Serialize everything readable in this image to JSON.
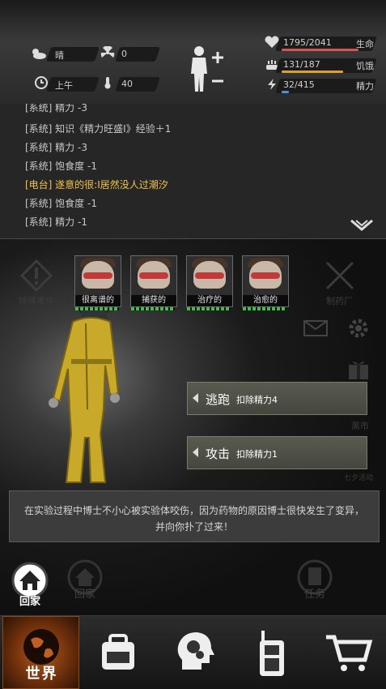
{
  "status": {
    "weather": "晴",
    "radiation": "0",
    "time": "上午",
    "temperature": "40",
    "life": {
      "value": "1795/2041",
      "label": "生命",
      "fraction": 0.88
    },
    "hunger": {
      "value": "131/187",
      "label": "饥饿",
      "fraction": 0.7
    },
    "energy": {
      "value": "32/415",
      "label": "精力",
      "fraction": 0.08
    }
  },
  "log": [
    {
      "text": "[系统] 精力 -3",
      "type": "system"
    },
    {
      "text": "[系统] 知识《精力旺盛Ⅰ》经验＋1",
      "type": "system"
    },
    {
      "text": "[系统] 精力 -3",
      "type": "system"
    },
    {
      "text": "[系统] 饱食度 -1",
      "type": "system"
    },
    {
      "text": "[电台] 遂意的很:I居然没人过潮汐",
      "type": "radio"
    },
    {
      "text": "[系统] 饱食度 -1",
      "type": "system"
    },
    {
      "text": "[系统] 精力 -1",
      "type": "system"
    }
  ],
  "enemies": [
    {
      "name": "很离谱的"
    },
    {
      "name": "捕获的"
    },
    {
      "name": "治疗的"
    },
    {
      "name": "治愈的"
    }
  ],
  "enemy_hp_fraction": [
    1,
    1,
    1,
    1
  ],
  "actions": [
    {
      "label": "逃跑",
      "cost": "扣除精力4"
    },
    {
      "label": "攻击",
      "cost": "扣除精力1"
    }
  ],
  "side_labels": {
    "special_event": "特殊事件",
    "pharmacy": "制药厂",
    "black_market": "黑市",
    "seven_day": "七夕活动"
  },
  "story": "在实验过程中博士不小心被实验体咬伤，因为药物的原因博士很快发生了变异，并向你扑了过来！",
  "home": {
    "active_label": "回家",
    "faded_label": "回家",
    "task_label": "任务"
  },
  "nav": {
    "world": "世界"
  },
  "colors": {
    "life": "#d9534f",
    "hunger": "#e0a030",
    "energy": "#4a90d9",
    "radio": "#f2c34a"
  }
}
